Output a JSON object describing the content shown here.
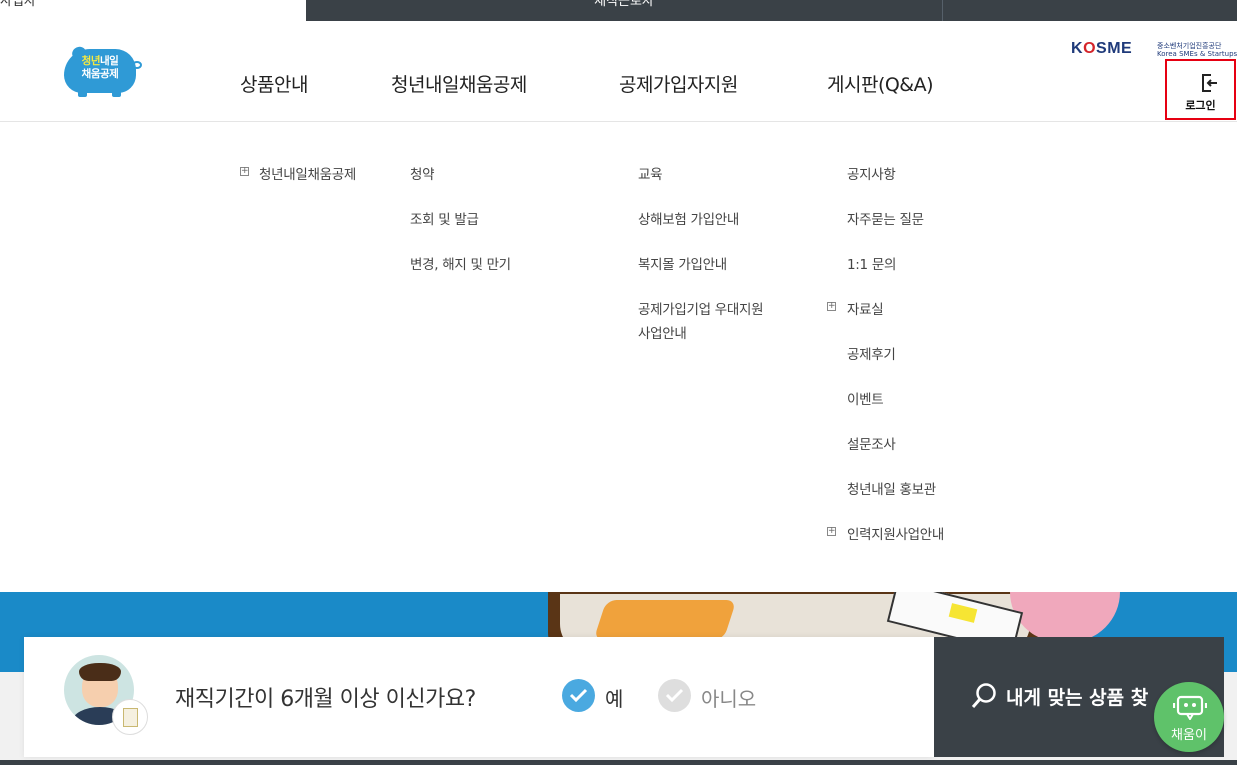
{
  "topbar": {
    "tab_active": "사업자",
    "tab_mid": "재직근로자",
    "tab_right": ""
  },
  "header": {
    "logo_line1_a": "청년",
    "logo_line1_b": "내일",
    "logo_line2": "채움공제",
    "kosme_logo": "KOSME",
    "kosme_sub_kr": "중소벤처기업진흥공단",
    "kosme_sub_en": "Korea SMEs & Startups Agency",
    "login_label": "로그인"
  },
  "gnb": {
    "items": [
      "상품안내",
      "청년내일채움공제",
      "공제가입자지원",
      "게시판(Q&A)"
    ]
  },
  "mega_menu": {
    "col1": [
      {
        "label": "청년내일채움공제",
        "expandable": true
      }
    ],
    "col2": [
      {
        "label": "청약"
      },
      {
        "label": "조회 및 발급"
      },
      {
        "label": "변경, 해지 및 만기"
      }
    ],
    "col3": [
      {
        "label": "교육"
      },
      {
        "label": "상해보험 가입안내"
      },
      {
        "label": "복지몰 가입안내"
      },
      {
        "label": "공제가입기업 우대지원"
      },
      {
        "label": "사업안내"
      }
    ],
    "col4": [
      {
        "label": "공지사항"
      },
      {
        "label": "자주묻는 질문"
      },
      {
        "label": "1:1 문의"
      },
      {
        "label": "자료실",
        "expandable": true
      },
      {
        "label": "공제후기"
      },
      {
        "label": "이벤트"
      },
      {
        "label": "설문조사"
      },
      {
        "label": "청년내일 홍보관"
      },
      {
        "label": "인력지원사업안내",
        "expandable": true
      }
    ]
  },
  "question": {
    "text": "재직기간이 6개월 이상 이신가요?",
    "yes_label": "예",
    "no_label": "아니오",
    "selected": "yes"
  },
  "find_button": {
    "label": "내게 맞는 상품 찾"
  },
  "chatbot": {
    "label": "채움이"
  },
  "icons": {
    "plus": "+",
    "login": "login-icon",
    "search": "search-icon",
    "check": "check-icon",
    "robot": "robot-icon"
  },
  "colors": {
    "accent_blue": "#4aa9e0",
    "dark": "#3a4147",
    "login_outline": "#e60012",
    "chatbot_green": "#5fc26a",
    "banner_blue": "#1a8ac8"
  }
}
